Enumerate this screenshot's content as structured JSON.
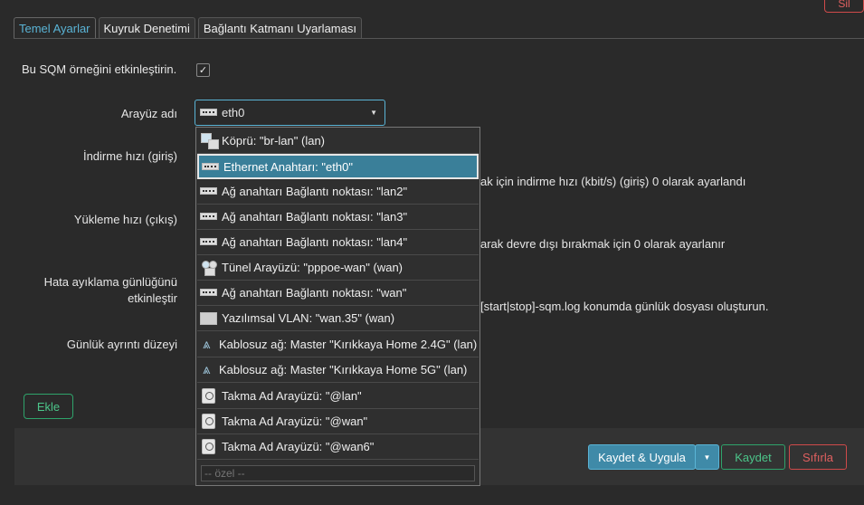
{
  "top_button": "Sil",
  "tabs": [
    "Temel Ayarlar",
    "Kuyruk Denetimi",
    "Bağlantı Katmanı Uyarlaması"
  ],
  "form": {
    "enable_label": "Bu SQM örneğini etkinleştirin.",
    "enable_checked": true,
    "interface_label": "Arayüz adı",
    "interface_value": "eth0",
    "download_label": "İndirme hızı (giriş)",
    "download_help": "ak için indirme hızı (kbit/s) (giriş) 0 olarak ayarlandı",
    "upload_label": "Yükleme hızı (çıkış)",
    "upload_help": "arak devre dışı bırakmak için 0 olarak ayarlanır",
    "debug_label_1": "Hata ayıklama günlüğünü",
    "debug_label_2": "etkinleştir",
    "debug_help": "[start|stop]-sqm.log konumda günlük dosyası oluşturun.",
    "verbosity_label": "Günlük ayrıntı düzeyi"
  },
  "dropdown": {
    "options": [
      {
        "icon": "bridge-icon",
        "label": "Köprü: \"br-lan\" (lan)"
      },
      {
        "icon": "ethernet-icon",
        "label": "Ethernet Anahtarı: \"eth0\"",
        "selected": true
      },
      {
        "icon": "ethernet-icon",
        "label": "Ağ anahtarı Bağlantı noktası: \"lan2\""
      },
      {
        "icon": "ethernet-icon",
        "label": "Ağ anahtarı Bağlantı noktası: \"lan3\""
      },
      {
        "icon": "ethernet-icon",
        "label": "Ağ anahtarı Bağlantı noktası: \"lan4\""
      },
      {
        "icon": "tunnel-icon",
        "label": "Tünel Arayüzü: \"pppoe-wan\" (wan)"
      },
      {
        "icon": "ethernet-icon",
        "label": "Ağ anahtarı Bağlantı noktası: \"wan\""
      },
      {
        "icon": "vlan-icon",
        "label": "Yazılımsal VLAN: \"wan.35\" (wan)"
      },
      {
        "icon": "wifi-icon",
        "label": "Kablosuz ağ: Master \"Kırıkkaya Home 2.4G\" (lan)"
      },
      {
        "icon": "wifi-icon",
        "label": "Kablosuz ağ: Master \"Kırıkkaya Home 5G\" (lan)"
      },
      {
        "icon": "alias-icon",
        "label": "Takma Ad Arayüzü: \"@lan\""
      },
      {
        "icon": "alias-icon",
        "label": "Takma Ad Arayüzü: \"@wan\""
      },
      {
        "icon": "alias-icon",
        "label": "Takma Ad Arayüzü: \"@wan6\""
      }
    ],
    "custom_placeholder": "-- özel --"
  },
  "buttons": {
    "add": "Ekle",
    "save_apply": "Kaydet & Uygula",
    "save": "Kaydet",
    "reset": "Sıfırla"
  },
  "colors": {
    "accent": "#5ab4d6",
    "positive": "#2fa36b",
    "negative": "#d04a4a"
  }
}
